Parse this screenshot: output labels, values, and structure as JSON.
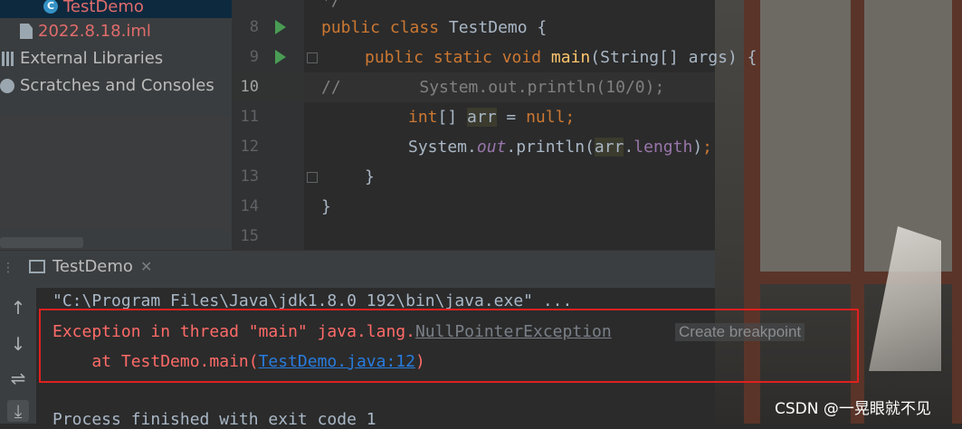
{
  "project_tree": {
    "items": [
      {
        "label": "TestDemo",
        "icon": "class-icon"
      },
      {
        "label": "2022.8.18.iml",
        "icon": "iml-file-icon"
      },
      {
        "label": "External Libraries",
        "icon": "libraries-icon"
      },
      {
        "label": "Scratches and Consoles",
        "icon": "scratches-icon"
      }
    ]
  },
  "editor": {
    "line_numbers": [
      "8",
      "9",
      "10",
      "11",
      "12",
      "13",
      "14",
      "15"
    ],
    "current_line": "10",
    "lines": {
      "l7": "*/",
      "l8_kw": "public class",
      "l8_name": " TestDemo {",
      "l9_kw": "public static void",
      "l9_fn": "main",
      "l9_rest": "(String[] args) {",
      "l10_comment": "//        System.out.println(10/0);",
      "l11_kw": "int",
      "l11_arr": "[] ",
      "l11_var": "arr",
      "l11_eq": " = ",
      "l11_null": "null",
      "l11_semi": ";",
      "l12_sys": "System.",
      "l12_out": "out",
      "l12_println": ".println(",
      "l12_arr": "arr",
      "l12_dot": ".",
      "l12_len": "length",
      "l12_end": ")",
      "l12_semi": ";",
      "l13": "}",
      "l14": "}"
    }
  },
  "run_window": {
    "tab_label": "TestDemo",
    "more_icon": "⋮",
    "console": {
      "cmd_line": "\"C:\\Program Files\\Java\\jdk1.8.0_192\\bin\\java.exe\" ...",
      "exc_prefix": "Exception in thread \"main\" java.lang.",
      "exc_class": "NullPointerException",
      "breakpoint_hint": "Create breakpoint",
      "at_prefix": "    at TestDemo.main(",
      "at_link": "TestDemo.java:12",
      "at_suffix": ")",
      "exit_line": "Process finished with exit code 1"
    }
  },
  "watermark": "CSDN @一晃眼就不见",
  "colors": {
    "keyword": "#cc7832",
    "function": "#ffc66d",
    "error": "#ff6b68",
    "link": "#287bde",
    "highlight_box": "#e02020"
  }
}
